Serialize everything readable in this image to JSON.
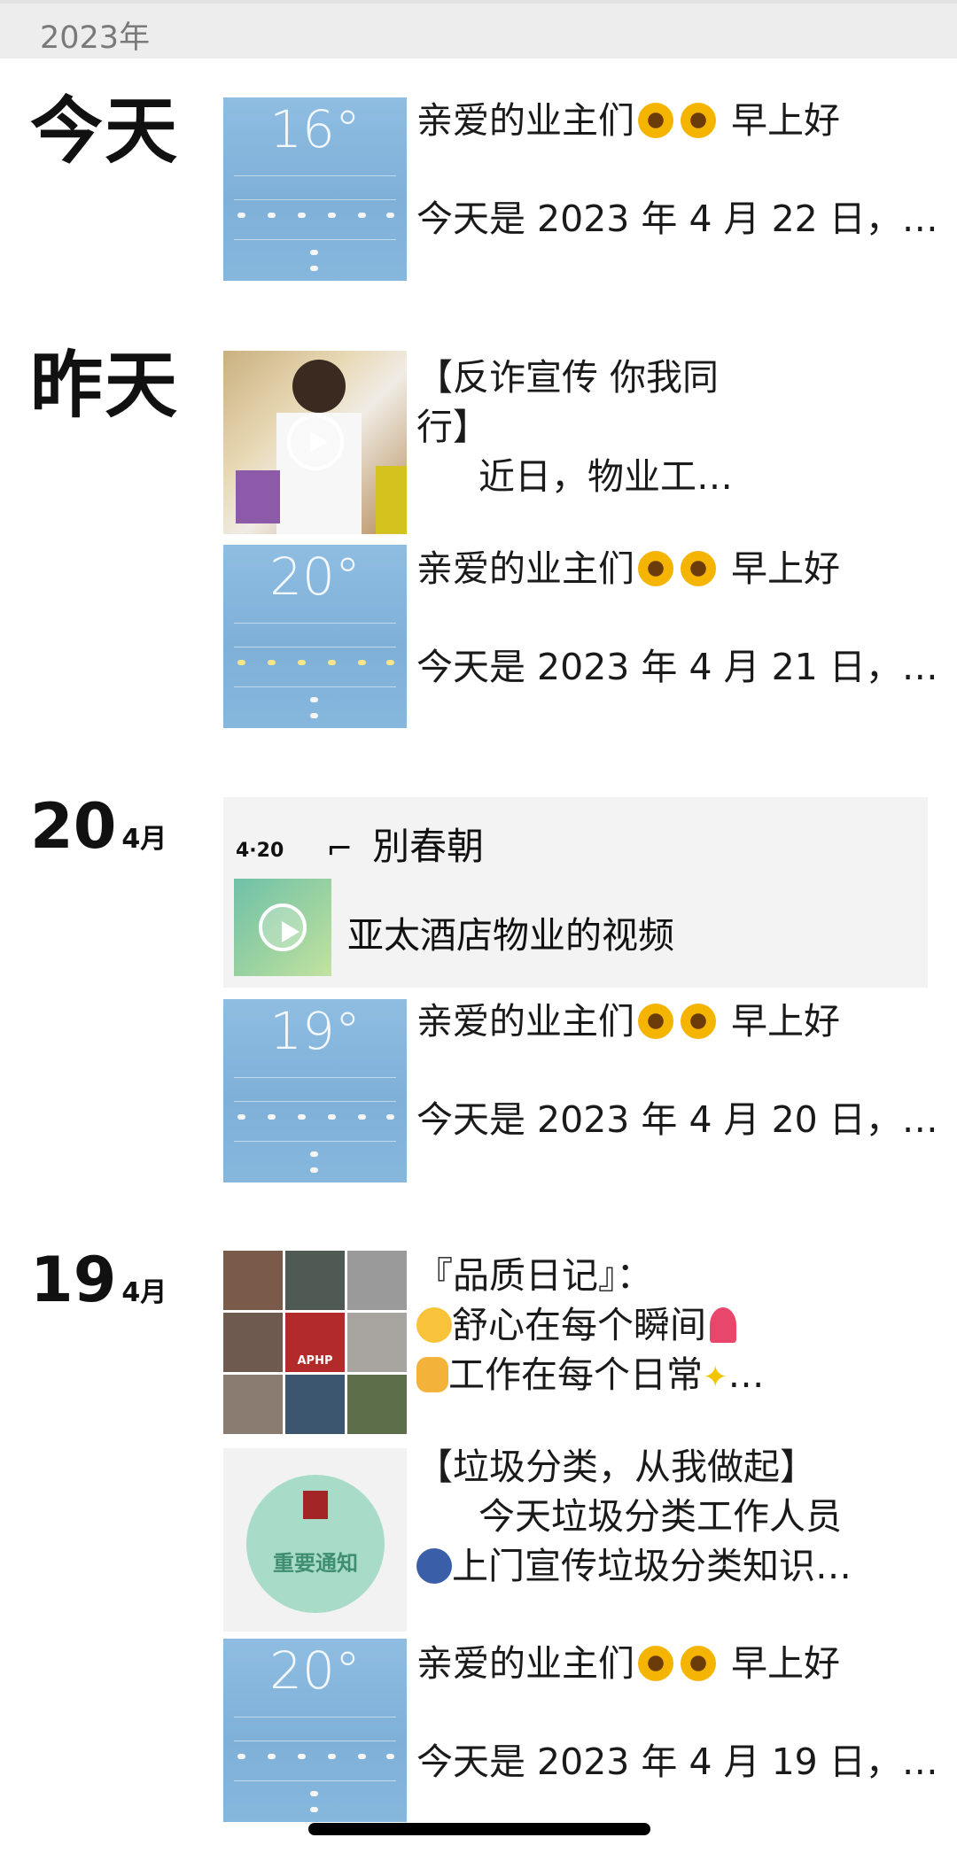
{
  "year_header": "2023年",
  "groups": {
    "today": {
      "label": "今天",
      "posts": [
        {
          "line1": "亲爱的业主们",
          "line1_tail": "早上好",
          "line2": "今天是 2023 年 4 月 22 日，…",
          "weather_temp": "16°"
        }
      ]
    },
    "yesterday": {
      "label": "昨天",
      "posts": [
        {
          "line1": "【反诈宣传 你我同",
          "line2": "行】",
          "line3": "近日，物业工…"
        },
        {
          "line1": "亲爱的业主们",
          "line1_tail": "早上好",
          "line2": "今天是 2023 年 4 月 21 日，…",
          "weather_temp": "20°"
        }
      ]
    },
    "apr20": {
      "day": "20",
      "month": "4月",
      "share": {
        "date_tag": "4·20",
        "quote": "別春朝",
        "video_title": "亚太酒店物业的视频"
      },
      "posts": [
        {
          "line1": "亲爱的业主们",
          "line1_tail": "早上好",
          "line2": "今天是 2023 年 4 月 20 日，…",
          "weather_temp": "19°"
        }
      ]
    },
    "apr19": {
      "day": "19",
      "month": "4月",
      "posts": [
        {
          "line1": "『品质日记』：",
          "line2": "舒心在每个瞬间",
          "line3": "工作在每个日常",
          "line3_tail": "…"
        },
        {
          "line1": "【垃圾分类，从我做起】",
          "line2": "今天垃圾分类工作人员",
          "line3": "上门宣传垃圾分类知识…",
          "thumb_text": "重要通知"
        },
        {
          "line1": "亲爱的业主们",
          "line1_tail": "早上好",
          "line2": "今天是 2023 年 4 月 19 日，…",
          "weather_temp": "20°"
        }
      ]
    }
  },
  "colors": {
    "weather_blue": "#8fbde2",
    "share_bg": "#f3f3f3",
    "year_bar": "#ededed"
  }
}
